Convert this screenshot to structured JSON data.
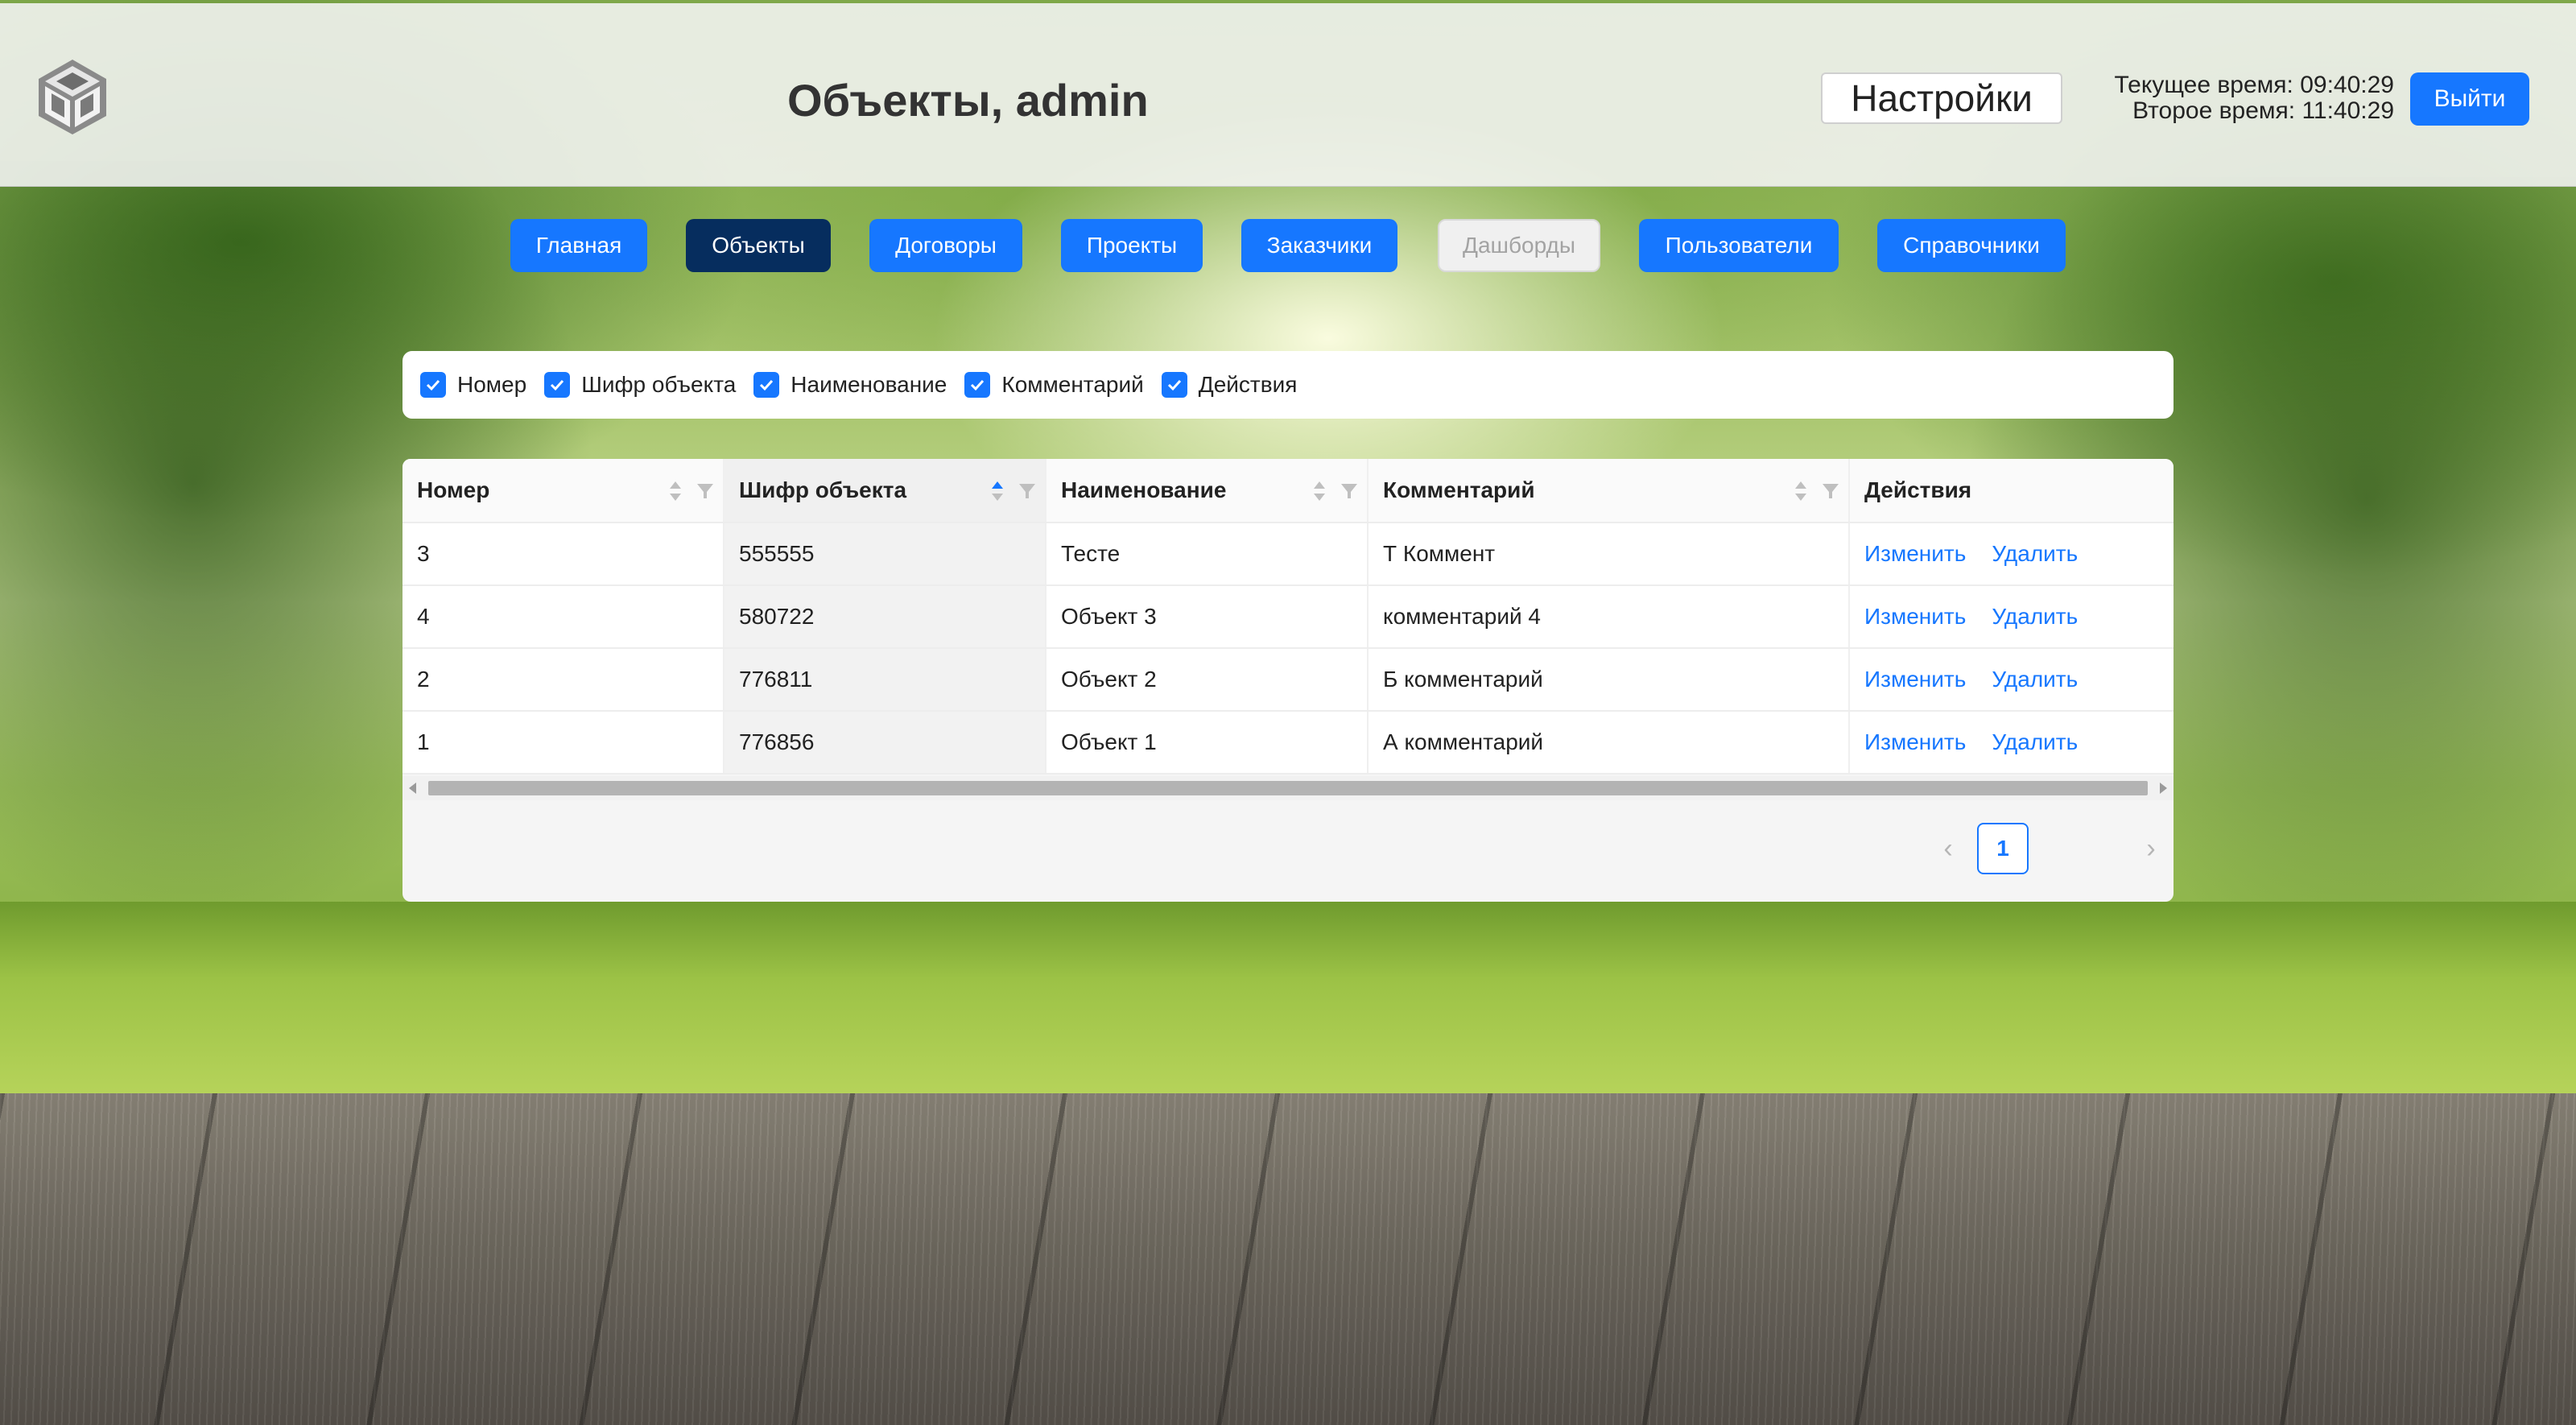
{
  "header": {
    "title": "Объекты, admin",
    "settings_label": "Настройки",
    "current_time": "Текущее время: 09:40:29",
    "second_time": "Второе время: 11:40:29",
    "logout_label": "Выйти",
    "logo_icon": "cube-logo-icon"
  },
  "nav": {
    "items": [
      {
        "label": "Главная",
        "state": "normal"
      },
      {
        "label": "Объекты",
        "state": "active"
      },
      {
        "label": "Договоры",
        "state": "normal"
      },
      {
        "label": "Проекты",
        "state": "normal"
      },
      {
        "label": "Заказчики",
        "state": "normal"
      },
      {
        "label": "Дашборды",
        "state": "disabled"
      },
      {
        "label": "Пользователи",
        "state": "normal"
      },
      {
        "label": "Справочники",
        "state": "normal"
      }
    ]
  },
  "column_toggles": [
    {
      "label": "Номер",
      "checked": true
    },
    {
      "label": "Шифр объекта",
      "checked": true
    },
    {
      "label": "Наименование",
      "checked": true
    },
    {
      "label": "Комментарий",
      "checked": true
    },
    {
      "label": "Действия",
      "checked": true
    }
  ],
  "table": {
    "columns": [
      "Номер",
      "Шифр объекта",
      "Наименование",
      "Комментарий",
      "Действия"
    ],
    "sorted_column": "Шифр объекта",
    "sort_direction": "ascending",
    "rows": [
      {
        "number": "3",
        "code": "555555",
        "name": "Тесте",
        "comment": "Т Коммент"
      },
      {
        "number": "4",
        "code": "580722",
        "name": "Объект 3",
        "comment": "комментарий 4"
      },
      {
        "number": "2",
        "code": "776811",
        "name": "Объект 2",
        "comment": "Б комментарий"
      },
      {
        "number": "1",
        "code": "776856",
        "name": "Объект 1",
        "comment": "А комментарий"
      }
    ],
    "actions": {
      "edit": "Изменить",
      "delete": "Удалить"
    }
  },
  "pagination": {
    "prev": "‹",
    "current_page": "1",
    "next": "›"
  },
  "colors": {
    "primary": "#1677ff",
    "nav_active": "#062d5e",
    "nav_disabled_text": "#a3a3a3"
  }
}
